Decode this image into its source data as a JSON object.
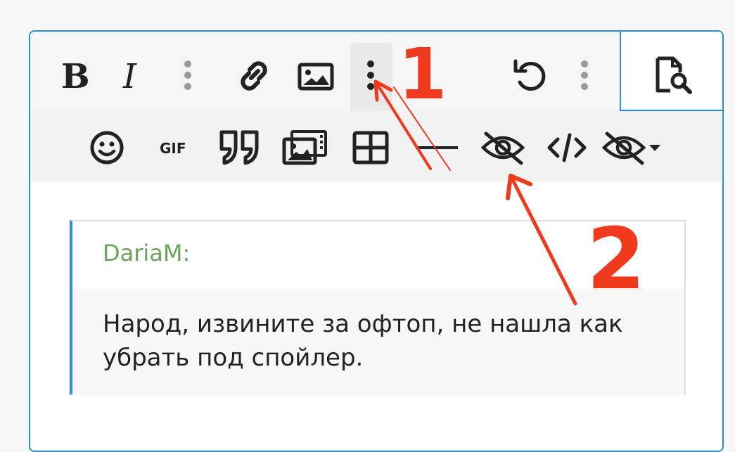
{
  "toolbar": {
    "row1": [
      {
        "name": "bold-button",
        "icon": "bold-icon",
        "glyph": "B"
      },
      {
        "name": "italic-button",
        "icon": "italic-icon",
        "glyph": "I"
      },
      {
        "name": "more-text-options-button",
        "icon": "vertical-dots-icon"
      },
      {
        "name": "insert-link-button",
        "icon": "link-icon"
      },
      {
        "name": "insert-image-button",
        "icon": "image-icon"
      },
      {
        "name": "more-insert-options-button",
        "icon": "vertical-dots-icon",
        "active": true
      },
      {
        "name": "undo-button",
        "icon": "undo-icon"
      },
      {
        "name": "more-options-button",
        "icon": "vertical-dots-icon"
      }
    ],
    "preview": {
      "name": "preview-button",
      "icon": "document-search-icon"
    },
    "row2": [
      {
        "name": "emoji-button",
        "icon": "smiley-icon"
      },
      {
        "name": "gif-button",
        "icon": "gif-icon",
        "glyph": "GIF"
      },
      {
        "name": "quote-button",
        "icon": "quote-icon"
      },
      {
        "name": "media-gallery-button",
        "icon": "media-icon"
      },
      {
        "name": "insert-table-button",
        "icon": "table-icon"
      },
      {
        "name": "horizontal-line-button",
        "icon": "horizontal-line-icon"
      },
      {
        "name": "spoiler-button",
        "icon": "eye-slash-icon"
      },
      {
        "name": "code-button",
        "icon": "code-icon"
      },
      {
        "name": "spoiler-dropdown-button",
        "icon": "eye-slash-dropdown-icon"
      }
    ]
  },
  "quote": {
    "author": "DariaM:",
    "text": "Народ, извините за офтоп, не нашла как убрать под спойлер."
  },
  "annotations": {
    "label_1": "1",
    "label_2": "2",
    "color": "#f03a1e"
  },
  "colors": {
    "accent": "#2c8ed6",
    "author": "#6aa35a",
    "icon": "#222222",
    "dots": "#9a9a9a"
  }
}
